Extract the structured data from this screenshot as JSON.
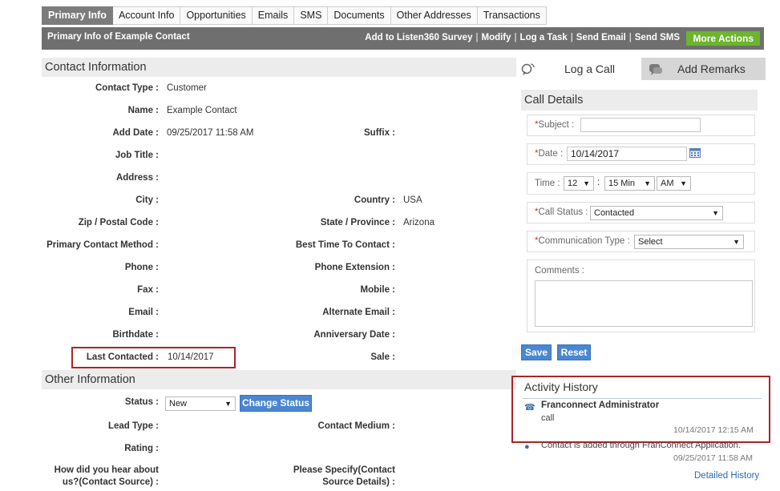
{
  "tabs": [
    "Primary Info",
    "Account Info",
    "Opportunities",
    "Emails",
    "SMS",
    "Documents",
    "Other Addresses",
    "Transactions"
  ],
  "titlebar": {
    "title": "Primary Info of Example Contact",
    "actions": [
      "Add to Listen360 Survey",
      "Modify",
      "Log a Task",
      "Send Email",
      "Send SMS"
    ],
    "more_actions": "More Actions"
  },
  "contact": {
    "section_title": "Contact Information",
    "contact_type_label": "Contact Type :",
    "contact_type": "Customer",
    "name_label": "Name :",
    "name": "Example Contact",
    "add_date_label": "Add Date :",
    "add_date": "09/25/2017 11:58 AM",
    "suffix_label": "Suffix :",
    "job_title_label": "Job Title :",
    "address_label": "Address :",
    "city_label": "City :",
    "country_label": "Country :",
    "country": "USA",
    "zip_label": "Zip / Postal Code :",
    "state_label": "State / Province :",
    "state": "Arizona",
    "primary_method_label": "Primary Contact Method :",
    "best_time_label": "Best Time To Contact :",
    "phone_label": "Phone :",
    "phone_ext_label": "Phone Extension :",
    "fax_label": "Fax :",
    "mobile_label": "Mobile :",
    "email_label": "Email :",
    "alt_email_label": "Alternate Email :",
    "birthdate_label": "Birthdate :",
    "anniversary_label": "Anniversary Date :",
    "last_contacted_label": "Last Contacted :",
    "last_contacted": "10/14/2017",
    "sale_label": "Sale :"
  },
  "other": {
    "section_title": "Other Information",
    "status_label": "Status :",
    "status_value": "New",
    "change_status": "Change Status",
    "lead_type_label": "Lead Type :",
    "contact_medium_label": "Contact Medium :",
    "rating_label": "Rating :",
    "source_label_1": "How did you hear about",
    "source_label_2": "us?(Contact Source) :",
    "specify_label_1": "Please Specify(Contact",
    "specify_label_2": "Source Details) :"
  },
  "right": {
    "log_call_tab": "Log a Call",
    "add_remarks_tab": "Add Remarks",
    "call_details_title": "Call Details",
    "subject_label": "Subject :",
    "date_label": "Date :",
    "date_value": "10/14/2017",
    "time_label": "Time :",
    "hour": "12",
    "minute": "15 Min",
    "ampm": "AM",
    "time_colon": ":",
    "call_status_label": "Call Status :",
    "call_status_value": "Contacted",
    "comm_type_label": "Communication Type :",
    "comm_type_value": "Select",
    "comments_label": "Comments :",
    "save": "Save",
    "reset": "Reset",
    "activity_title": "Activity History",
    "activity_author": "Franconnect Administrator",
    "activity_text": "call",
    "activity_time": "10/14/2017 12:15 AM",
    "activity2_text": "Contact is added through FranConnect Application.",
    "activity2_time": "09/25/2017 11:58 AM",
    "detailed_history": "Detailed History"
  },
  "colors": {
    "accent_blue": "#4a86d1",
    "more_green": "#6cb52d",
    "highlight_red": "#a8262a",
    "titlebar_gray": "#6f6f6f"
  }
}
